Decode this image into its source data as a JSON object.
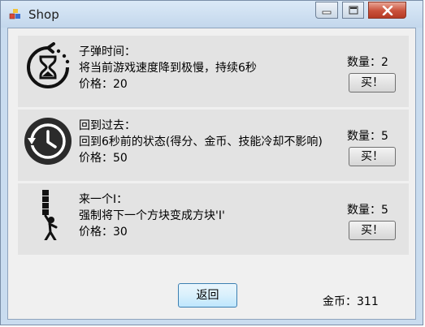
{
  "window": {
    "title": "Shop"
  },
  "items": [
    {
      "name": "子弹时间：",
      "description": "将当前游戏速度降到极慢，持续6秒",
      "price": "价格：20",
      "quantity": "数量：2",
      "buy_label": "买！",
      "icon": "hourglass-icon"
    },
    {
      "name": "回到过去：",
      "description": "回到6秒前的状态(得分、金币、技能冷却不影响)",
      "price": "价格：50",
      "quantity": "数量：5",
      "buy_label": "买！",
      "icon": "history-icon"
    },
    {
      "name": "来一个I：",
      "description": "强制将下一个方块变成方块'I'",
      "price": "价格：30",
      "quantity": "数量：5",
      "buy_label": "买！",
      "icon": "i-block-icon"
    }
  ],
  "footer": {
    "back_label": "返回",
    "coins": "金币：311"
  }
}
